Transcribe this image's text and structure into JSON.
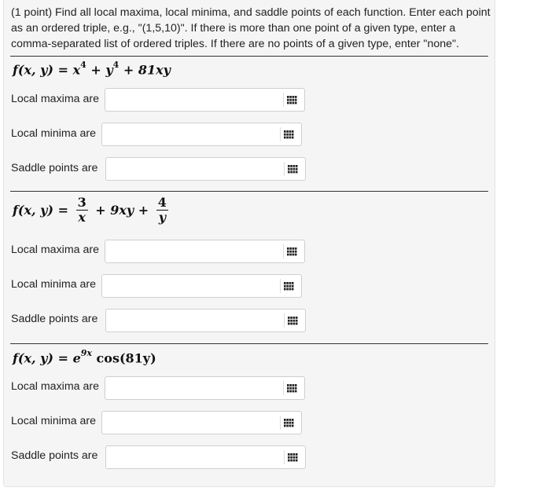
{
  "intro": {
    "text": "(1 point) Find all local maxima, local minima, and saddle points of each function. Enter each point as an ordered triple, e.g., \"(1,5,10)\". If there is more than one point of a given type, enter a comma-separated list of ordered triples. If there are no points of a given type, enter \"none\"."
  },
  "problems": [
    {
      "formula": {
        "lhs": "f(x, y) =",
        "term1": "x",
        "exp1": "4",
        "plus1": "+",
        "term2": "y",
        "exp2": "4",
        "rest": "+ 81xy"
      },
      "rows": [
        {
          "label": "Local maxima are",
          "value": ""
        },
        {
          "label": "Local minima are",
          "value": ""
        },
        {
          "label": "Saddle points are",
          "value": ""
        }
      ]
    },
    {
      "formula": {
        "lhs": "f(x, y) =",
        "num1": "3",
        "den1": "x",
        "mid": "+ 9xy +",
        "num2": "4",
        "den2": "y"
      },
      "rows": [
        {
          "label": "Local maxima are",
          "value": ""
        },
        {
          "label": "Local minima are",
          "value": ""
        },
        {
          "label": "Saddle points are",
          "value": ""
        }
      ]
    },
    {
      "formula": {
        "lhs": "f(x, y) =",
        "base": "e",
        "exp": "9x",
        "rest": "cos(81y)"
      },
      "rows": [
        {
          "label": "Local maxima are",
          "value": ""
        },
        {
          "label": "Local minima are",
          "value": ""
        },
        {
          "label": "Saddle points are",
          "value": ""
        }
      ]
    }
  ],
  "icons": {
    "input_tool": "keyboard-grid-icon"
  }
}
